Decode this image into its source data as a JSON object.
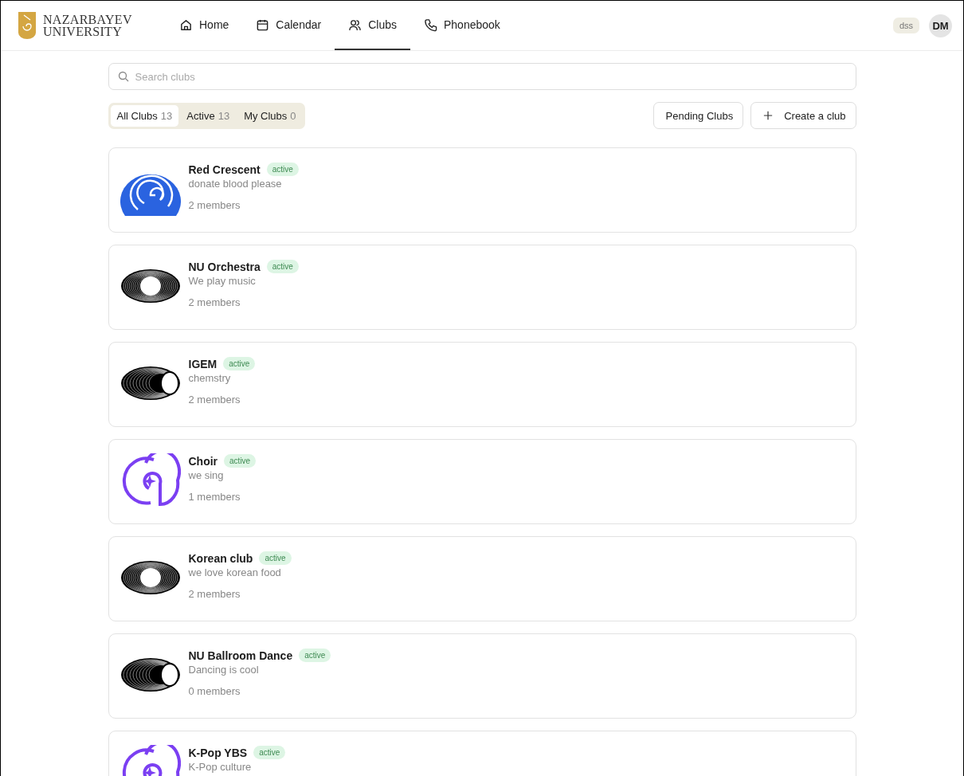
{
  "brand": {
    "line_1": "NAZARBAYEV",
    "line_2": "UNIVERSITY"
  },
  "nav": [
    {
      "label": "Home",
      "selected": false
    },
    {
      "label": "Calendar",
      "selected": false
    },
    {
      "label": "Clubs",
      "selected": true
    },
    {
      "label": "Phonebook",
      "selected": false
    }
  ],
  "user": {
    "tag": "dss",
    "initials": "DM"
  },
  "search": {
    "placeholder": "Search clubs"
  },
  "filters": [
    {
      "label": "All Clubs",
      "count": "13",
      "selected": true
    },
    {
      "label": "Active",
      "count": "13",
      "selected": false
    },
    {
      "label": "My Clubs",
      "count": "0",
      "selected": false
    }
  ],
  "actions": [
    {
      "label": "Pending Clubs"
    },
    {
      "label": "Create a club"
    }
  ],
  "clubs": [
    {
      "kind": "spiral",
      "name": "Red Crescent",
      "status": "active",
      "description": "donate blood please",
      "members": "2 members"
    },
    {
      "kind": "rings",
      "name": "NU Orchestra",
      "status": "active",
      "description": "We play music",
      "members": "2 members"
    },
    {
      "kind": "offset",
      "name": "IGEM",
      "status": "active",
      "description": "chemstry",
      "members": "2 members"
    },
    {
      "kind": "loop",
      "name": "Choir",
      "status": "active",
      "description": "we sing",
      "members": "1 members"
    },
    {
      "kind": "rings",
      "name": "Korean club",
      "status": "active",
      "description": "we love korean food",
      "members": "2 members"
    },
    {
      "kind": "offset",
      "name": "NU Ballroom Dance",
      "status": "active",
      "description": "Dancing is cool",
      "members": "0 members"
    },
    {
      "kind": "loop",
      "name": "K-Pop YBS",
      "status": "active",
      "description": "K-Pop culture"
    }
  ]
}
